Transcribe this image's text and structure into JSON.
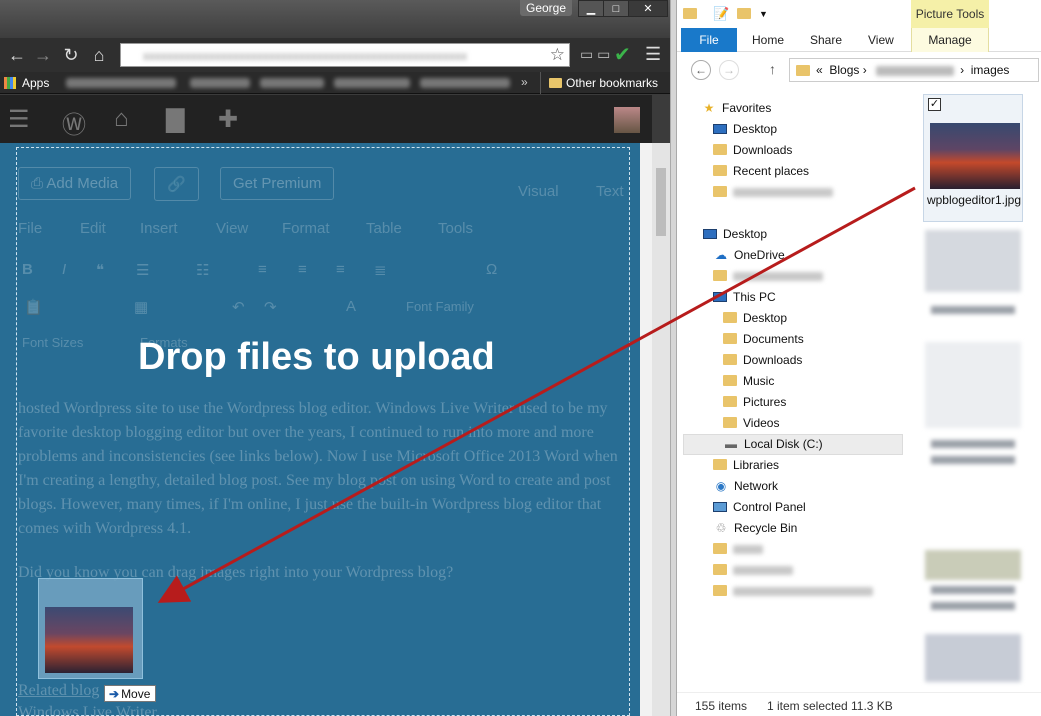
{
  "chrome": {
    "user_name": "George",
    "bookmarks": {
      "apps_label": "Apps",
      "more": "»",
      "other_label": "Other bookmarks"
    }
  },
  "editor": {
    "buttons": [
      "Add Media",
      "Get Premium"
    ],
    "modes": [
      "Visual",
      "Text"
    ],
    "menus": [
      "File",
      "Edit",
      "Insert",
      "View",
      "Format",
      "Table",
      "Tools"
    ],
    "font_family_placeholder": "Font Family",
    "font_sizes_placeholder": "Font Sizes",
    "formats_placeholder": "Formats",
    "drop_message": "Drop files to upload",
    "paragraph_1": "hosted Wordpress site to use the Wordpress blog editor. Windows Live Writer used to be my favorite desktop blogging editor but over the years, I continued to run into more and more problems and inconsistencies (see links below). Now I use Microsoft Office 2013 Word when I'm creating a lengthy, detailed blog post. See my blog post on using Word to create and post blogs. However, many times, if I'm online, I just use the built-in Wordpress blog editor that comes with Wordpress 4.1.",
    "paragraph_2": "Did you know you can drag images right into your Wordpress blog?",
    "related_label": "Related blog",
    "related_item": "Windows Live Writer",
    "move_badge": "Move"
  },
  "explorer": {
    "context_tab": "Picture Tools",
    "tabs": [
      "File",
      "Home",
      "Share",
      "View",
      "Manage"
    ],
    "breadcrumb": {
      "prefix": "«",
      "part1": "Blogs",
      "part2": "images"
    },
    "nav": {
      "favorites": "Favorites",
      "fav_items": [
        "Desktop",
        "Downloads",
        "Recent places"
      ],
      "desktop": "Desktop",
      "onedrive": "OneDrive",
      "this_pc": "This PC",
      "pc_items": [
        "Desktop",
        "Documents",
        "Downloads",
        "Music",
        "Pictures",
        "Videos"
      ],
      "local_disk": "Local Disk (C:)",
      "libraries": "Libraries",
      "network": "Network",
      "control_panel": "Control Panel",
      "recycle_bin": "Recycle Bin"
    },
    "selected_file": "wpblogeditor1.jpg",
    "status": {
      "count": "155 items",
      "selected": "1 item selected",
      "size": "11.3 KB"
    }
  },
  "colors": {
    "overlay": "#17628c",
    "arrow": "#b71c1c",
    "ribbon_file": "#1979ca"
  }
}
